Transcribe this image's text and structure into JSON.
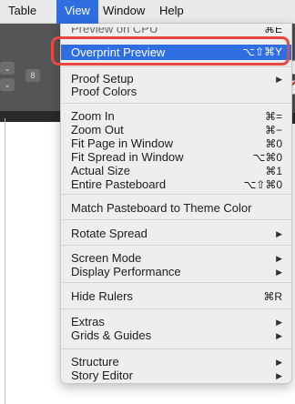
{
  "menubar": {
    "items": [
      {
        "label": "Table"
      },
      {
        "label": "View"
      },
      {
        "label": "Window"
      },
      {
        "label": "Help"
      }
    ]
  },
  "app": {
    "link_glyph": "8"
  },
  "menu": {
    "partial_item": {
      "label": "Preview on CPU",
      "shortcut": "⌘E"
    },
    "highlighted": {
      "label": "Overprint Preview",
      "shortcut": "⌥⇧⌘Y"
    },
    "items": [
      {
        "label": "Proof Setup",
        "shortcut": "▶"
      },
      {
        "label": "Proof Colors",
        "shortcut": ""
      },
      {
        "label": "Zoom In",
        "shortcut": "⌘="
      },
      {
        "label": "Zoom Out",
        "shortcut": "⌘−"
      },
      {
        "label": "Fit Page in Window",
        "shortcut": "⌘0"
      },
      {
        "label": "Fit Spread in Window",
        "shortcut": "⌥⌘0"
      },
      {
        "label": "Actual Size",
        "shortcut": "⌘1"
      },
      {
        "label": "Entire Pasteboard",
        "shortcut": "⌥⇧⌘0"
      },
      {
        "label": "Match Pasteboard to Theme Color",
        "shortcut": ""
      },
      {
        "label": "Rotate Spread",
        "shortcut": "▶"
      },
      {
        "label": "Screen Mode",
        "shortcut": "▶"
      },
      {
        "label": "Display Performance",
        "shortcut": "▶"
      },
      {
        "label": "Hide Rulers",
        "shortcut": "⌘R"
      },
      {
        "label": "Extras",
        "shortcut": "▶"
      },
      {
        "label": "Grids & Guides",
        "shortcut": "▶"
      },
      {
        "label": "Structure",
        "shortcut": "▶"
      },
      {
        "label": "Story Editor",
        "shortcut": "▶"
      }
    ]
  },
  "colors": {
    "highlight": "#2f6ee0",
    "callout": "#e8473f"
  }
}
